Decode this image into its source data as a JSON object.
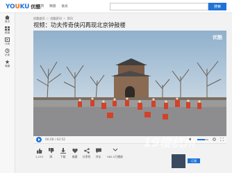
{
  "header": {
    "logo_text_a": "YO",
    "logo_text_b": "U",
    "logo_text_c": "KU",
    "logo_cn": "优酷",
    "nav": [
      "首页",
      "频道",
      "会员"
    ],
    "search_placeholder": "",
    "search_button": "搜索"
  },
  "sidebar": {
    "items": [
      {
        "label": "首页",
        "icon": "home-icon"
      },
      {
        "label": "频道",
        "icon": "channel-icon"
      },
      {
        "label": "订阅",
        "icon": "subscribe-icon"
      },
      {
        "label": "记录",
        "icon": "history-icon"
      },
      {
        "label": "收藏",
        "icon": "star-icon"
      }
    ]
  },
  "breadcrumb": [
    "优酷首页",
    "优酷资讯",
    "资讯"
  ],
  "video": {
    "title": "视频：功夫传奇侠闪再现北京钟鼓楼",
    "watermark": "优酷",
    "time": "00:28 / 02:52",
    "progress": 0.16
  },
  "actions": [
    {
      "label": "1,233",
      "icon": "thumbs-up-icon"
    },
    {
      "label": "踩",
      "icon": "thumbs-down-icon"
    },
    {
      "label": "下载",
      "icon": "download-icon"
    },
    {
      "label": "收藏",
      "icon": "heart-icon"
    },
    {
      "label": "分享到",
      "icon": "share-icon"
    },
    {
      "label": "评论",
      "icon": "comment-icon"
    },
    {
      "label": "582.5万播放",
      "icon": "play-count-icon"
    }
  ],
  "uploader": {
    "subscribe_label": "订阅"
  },
  "overlay_brand": "19楼杭州"
}
